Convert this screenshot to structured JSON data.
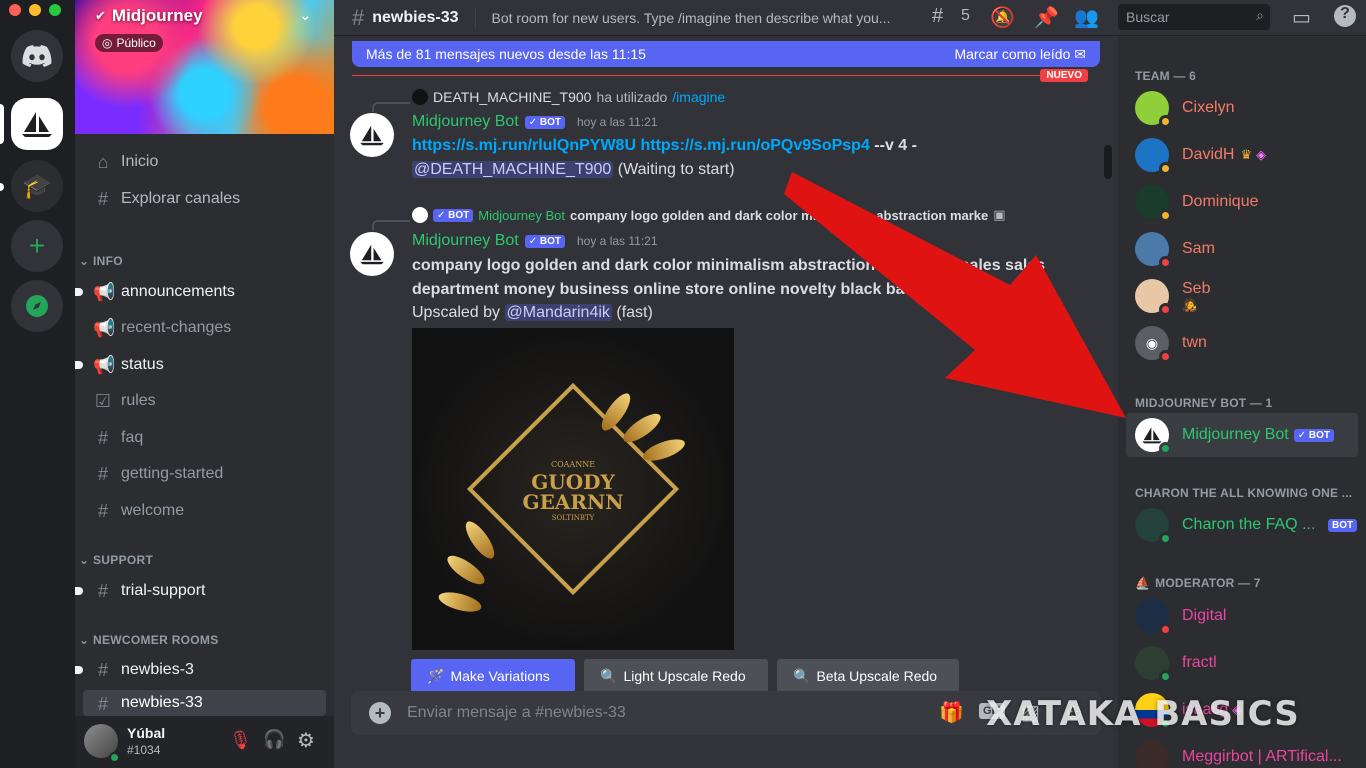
{
  "server": {
    "name": "Midjourney",
    "visibility": "Público"
  },
  "nav": {
    "home": "Inicio",
    "explore": "Explorar canales"
  },
  "categories": {
    "info": "INFO",
    "support": "SUPPORT",
    "newcomer": "NEWCOMER ROOMS"
  },
  "channels": {
    "announcements": "announcements",
    "recent_changes": "recent-changes",
    "status": "status",
    "rules": "rules",
    "faq": "faq",
    "getting_started": "getting-started",
    "welcome": "welcome",
    "trial_support": "trial-support",
    "newbies_3": "newbies-3",
    "newbies_33": "newbies-33"
  },
  "user": {
    "name": "Yúbal",
    "tag": "#1034"
  },
  "header": {
    "channel": "newbies-33",
    "topic": "Bot room for new users. Type /imagine then describe what you...",
    "threads_count": "5",
    "search_placeholder": "Buscar"
  },
  "banner": {
    "text": "Más de 81 mensajes nuevos desde las 11:15",
    "mark_read": "Marcar como leído",
    "new_tag": "NUEVO"
  },
  "messages": {
    "m1": {
      "reply_user": "DEATH_MACHINE_T900",
      "reply_used": "ha utilizado",
      "reply_cmd": "/imagine",
      "author": "Midjourney Bot",
      "bot": "BOT",
      "time": "hoy a las 11:21",
      "link1": "https://s.mj.run/rlulQnPYW8U",
      "link2": "https://s.mj.run/oPQv9SoPsp4",
      "params": "--v 4 -",
      "mention": "@DEATH_MACHINE_T900",
      "status": "(Waiting to start)"
    },
    "m2": {
      "reply_bot": "BOT",
      "reply_author": "Midjourney Bot",
      "reply_text": "company logo golden and dark color minimalism abstraction marke",
      "author": "Midjourney Bot",
      "bot": "BOT",
      "time": "hoy a las 11:21",
      "line1": "company logo golden and dark color minimalism abstraction marketing sales sales",
      "line2": "department money business online store online novelty black background",
      "upscaled_by": "Upscaled by",
      "mention": "@Mandarin4ik",
      "speed": "(fast)",
      "image_top": "COAANNE",
      "image_title1": "GUODY",
      "image_title2": "GEARNN",
      "image_bottom": "SOLTINBTY"
    }
  },
  "buttons": {
    "variations": "Make Variations",
    "light": "Light Upscale Redo",
    "beta": "Beta Upscale Redo"
  },
  "composer": {
    "placeholder": "Enviar mensaje a #newbies-33",
    "gif": "GIF"
  },
  "members": {
    "team_header": "TEAM — 6",
    "team": [
      "Cixelyn",
      "DavidH",
      "Dominique",
      "Sam",
      "Seb",
      "twn"
    ],
    "bot_header": "MIDJOURNEY BOT — 1",
    "bot_name": "Midjourney Bot",
    "bot_tag": "BOT",
    "charon_header": "CHARON THE ALL KNOWING ONE ...",
    "charon_name": "Charon the FAQ ...",
    "charon_tag": "BOT",
    "mod_header": "MODERATOR — 7",
    "mods": [
      "Digital",
      "fractl",
      "isaacg",
      "Meggirbot | ARTifical..."
    ]
  },
  "watermark": "XATAKA BASICS",
  "colors": {
    "accent": "#5865f2",
    "online": "#23a55a",
    "dnd": "#f23f43",
    "idle": "#f0b232",
    "team": "#f47b67",
    "moderator": "#eb459e",
    "bot_name": "#2dc770",
    "arrow": "#e01313"
  }
}
